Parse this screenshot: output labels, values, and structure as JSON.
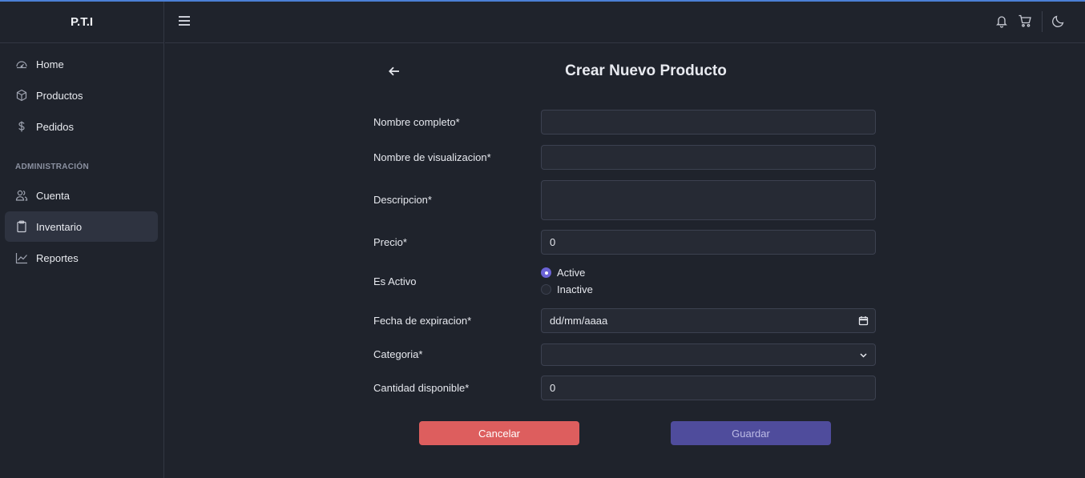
{
  "app": {
    "brand": "P.T.I"
  },
  "sidebar": {
    "items": [
      {
        "label": "Home",
        "icon": "dashboard-icon"
      },
      {
        "label": "Productos",
        "icon": "box-icon"
      },
      {
        "label": "Pedidos",
        "icon": "dollar-icon"
      }
    ],
    "section_label": "ADMINISTRACIÓN",
    "admin_items": [
      {
        "label": "Cuenta",
        "icon": "users-icon"
      },
      {
        "label": "Inventario",
        "icon": "clipboard-icon",
        "active": true
      },
      {
        "label": "Reportes",
        "icon": "chart-line-icon"
      }
    ]
  },
  "header": {
    "icons": [
      "menu-icon",
      "bell-icon",
      "cart-icon",
      "moon-icon"
    ]
  },
  "form": {
    "title": "Crear Nuevo Producto",
    "fields": {
      "nombre_completo": {
        "label": "Nombre completo*",
        "value": ""
      },
      "nombre_visualizacion": {
        "label": "Nombre de visualizacion*",
        "value": ""
      },
      "descripcion": {
        "label": "Descripcion*",
        "value": ""
      },
      "precio": {
        "label": "Precio*",
        "value": "0"
      },
      "es_activo": {
        "label": "Es Activo",
        "options": [
          "Active",
          "Inactive"
        ],
        "selected": "Active"
      },
      "fecha_expiracion": {
        "label": "Fecha de expiracion*",
        "value": "dd/mm/aaaa"
      },
      "categoria": {
        "label": "Categoria*",
        "value": ""
      },
      "cantidad": {
        "label": "Cantidad disponible*",
        "value": "0"
      }
    },
    "buttons": {
      "cancel": "Cancelar",
      "save": "Guardar"
    }
  },
  "colors": {
    "background": "#1f232c",
    "input_bg": "#262a34",
    "cancel": "#dd5e5e",
    "save": "#4f4c9c",
    "radio_accent": "#6b63d6",
    "top_accent": "#4b7fd6"
  }
}
